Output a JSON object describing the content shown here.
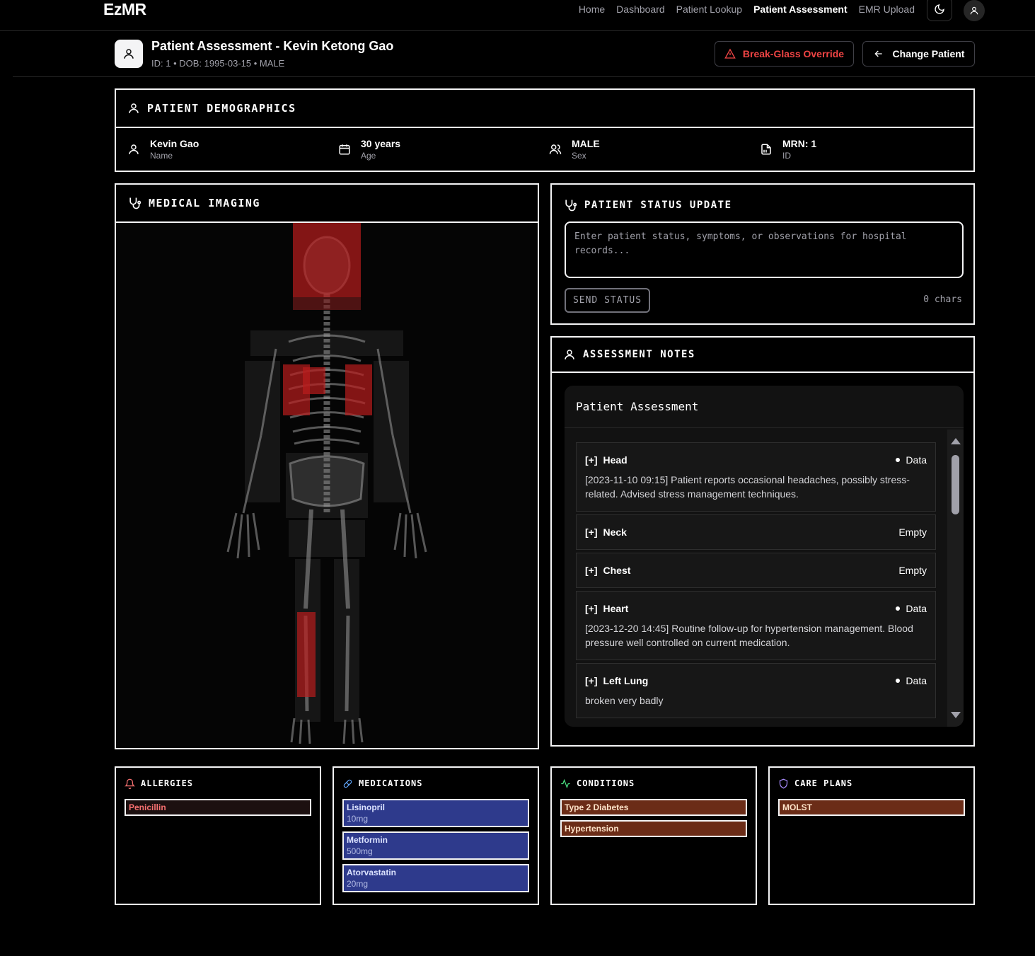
{
  "app": {
    "brand": "EzMR"
  },
  "nav": {
    "items": [
      "Home",
      "Dashboard",
      "Patient Lookup",
      "Patient Assessment",
      "EMR Upload"
    ],
    "active": "Patient Assessment"
  },
  "patient_header": {
    "title": "Patient Assessment - Kevin Ketong Gao",
    "subtitle": "ID: 1 • DOB: 1995-03-15 • MALE",
    "break_glass_label": "Break-Glass Override",
    "change_patient_label": "Change Patient"
  },
  "demographics": {
    "title": "PATIENT DEMOGRAPHICS",
    "items": [
      {
        "value": "Kevin Gao",
        "label": "Name",
        "icon": "user-icon"
      },
      {
        "value": "30 years",
        "label": "Age",
        "icon": "calendar-icon"
      },
      {
        "value": "MALE",
        "label": "Sex",
        "icon": "users-icon"
      },
      {
        "value": "MRN: 1",
        "label": "ID",
        "icon": "file-id-icon"
      }
    ]
  },
  "imaging": {
    "title": "MEDICAL IMAGING",
    "highlighted_regions": [
      "Head",
      "Left Lung",
      "Right Lung",
      "Heart",
      "Right Leg"
    ]
  },
  "status_update": {
    "title": "PATIENT STATUS UPDATE",
    "placeholder": "Enter patient status, symptoms, or observations for hospital records...",
    "value": "",
    "send_label": "SEND STATUS",
    "char_count": "0 chars"
  },
  "assessment_notes": {
    "title": "ASSESSMENT NOTES",
    "panel_title": "Patient Assessment",
    "notes": [
      {
        "toggle": "[+]",
        "name": "Head",
        "status": "Data",
        "text": "[2023-11-10 09:15] Patient reports occasional headaches, possibly stress-related. Advised stress management techniques."
      },
      {
        "toggle": "[+]",
        "name": "Neck",
        "status": "Empty",
        "text": ""
      },
      {
        "toggle": "[+]",
        "name": "Chest",
        "status": "Empty",
        "text": ""
      },
      {
        "toggle": "[+]",
        "name": "Heart",
        "status": "Data",
        "text": "[2023-12-20 14:45] Routine follow-up for hypertension management. Blood pressure well controlled on current medication."
      },
      {
        "toggle": "[+]",
        "name": "Left Lung",
        "status": "Data",
        "text": "broken very badly"
      }
    ]
  },
  "allergies": {
    "title": "ALLERGIES",
    "items": [
      {
        "name": "Penicillin"
      }
    ],
    "color": "#f87171"
  },
  "medications": {
    "title": "MEDICATIONS",
    "items": [
      {
        "name": "Lisinopril",
        "dose": "10mg"
      },
      {
        "name": "Metformin",
        "dose": "500mg"
      },
      {
        "name": "Atorvastatin",
        "dose": "20mg"
      }
    ],
    "color": "#2e3a8c"
  },
  "conditions": {
    "title": "CONDITIONS",
    "items": [
      {
        "name": "Type 2 Diabetes"
      },
      {
        "name": "Hypertension"
      }
    ],
    "color": "#6b2c17"
  },
  "care_plans": {
    "title": "CARE PLANS",
    "items": [
      {
        "name": "MOLST"
      }
    ],
    "color": "#6b2c17"
  }
}
